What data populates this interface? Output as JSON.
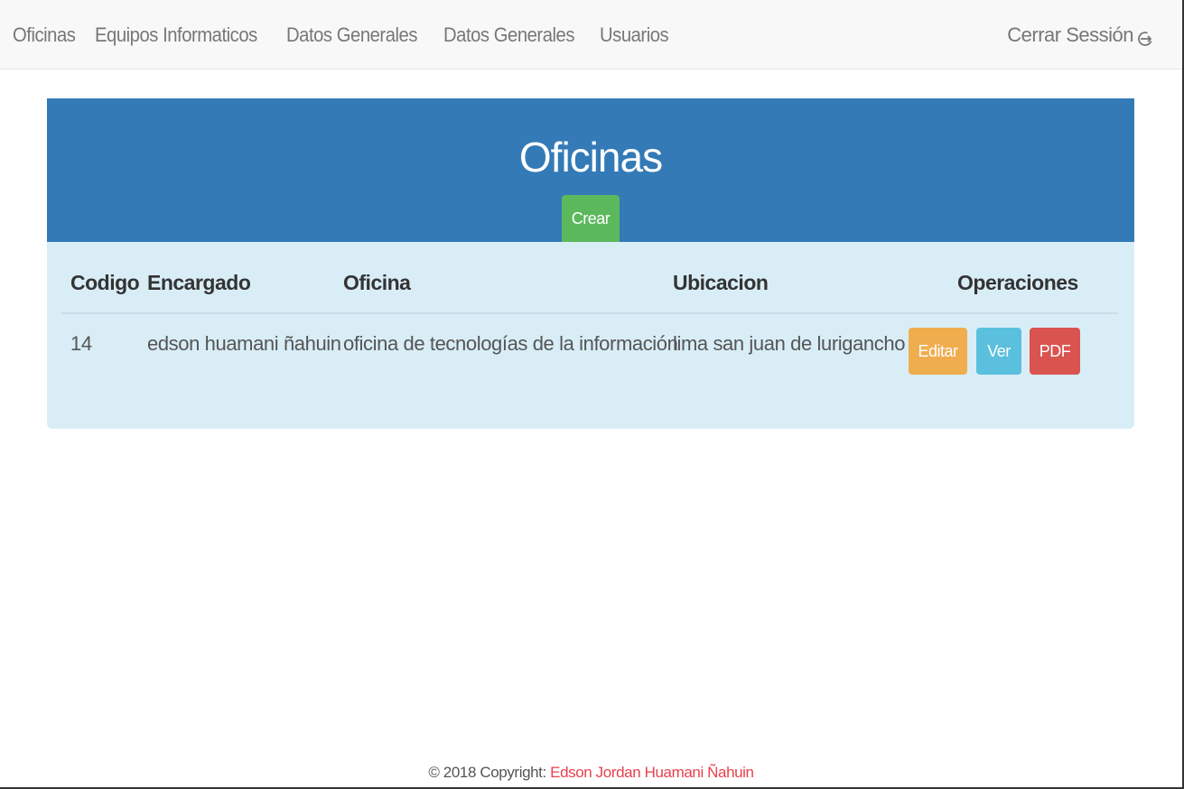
{
  "nav": {
    "links": [
      {
        "label": "Oficinas"
      },
      {
        "label": "Equipos Informaticos"
      },
      {
        "label": "Datos Generales"
      },
      {
        "label": "Datos Generales"
      },
      {
        "label": "Usuarios"
      }
    ],
    "logout_label": "Cerrar Sessión",
    "logout_icon": "logout-icon"
  },
  "panel": {
    "title": "Oficinas",
    "create_label": "Crear",
    "colors": {
      "header": "#337ab7",
      "body": "#d9edf7",
      "create": "#5cb85c"
    }
  },
  "table": {
    "headers": [
      "Codigo",
      "Encargado",
      "Oficina",
      "Ubicacion",
      "Operaciones"
    ],
    "rows": [
      {
        "codigo": "14",
        "encargado": "edson huamani ñahuin",
        "oficina": "oficina de tecnologías de la información",
        "ubicacion": "lima san juan de lurigancho",
        "actions": {
          "edit": "Editar",
          "view": "Ver",
          "pdf": "PDF"
        }
      }
    ]
  },
  "footer": {
    "prefix": "© 2018 Copyright: ",
    "author": "Edson Jordan Huamani Ñahuin"
  }
}
